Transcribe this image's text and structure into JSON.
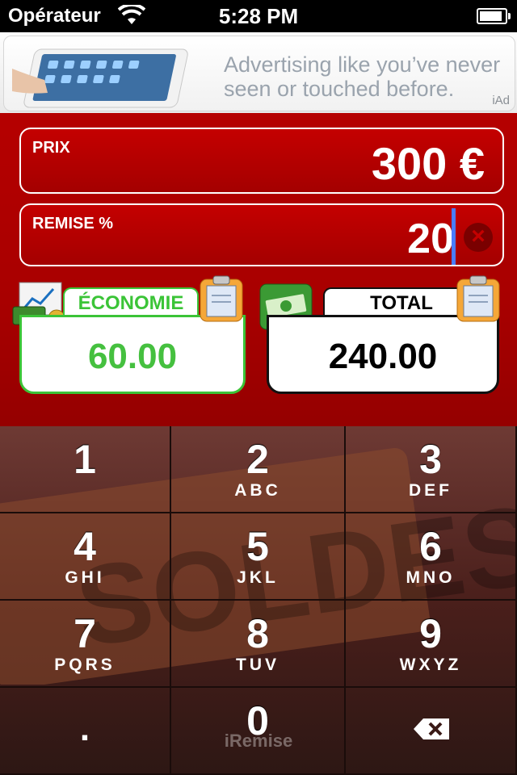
{
  "status_bar": {
    "carrier": "Opérateur",
    "time": "5:28 PM",
    "battery_level": 0.9
  },
  "ad": {
    "text": "Advertising like you’ve never seen or touched before.",
    "badge": "iAd"
  },
  "prix": {
    "label": "PRIX",
    "value": "300 €"
  },
  "remise": {
    "label": "REMISE %",
    "value": "20"
  },
  "economie": {
    "label": "ÉCONOMIE",
    "value": "60.00"
  },
  "total": {
    "label": "TOTAL",
    "value": "240.00"
  },
  "keypad": {
    "keys": [
      {
        "num": "1",
        "letters": ""
      },
      {
        "num": "2",
        "letters": "ABC"
      },
      {
        "num": "3",
        "letters": "DEF"
      },
      {
        "num": "4",
        "letters": "GHI"
      },
      {
        "num": "5",
        "letters": "JKL"
      },
      {
        "num": "6",
        "letters": "MNO"
      },
      {
        "num": "7",
        "letters": "PQRS"
      },
      {
        "num": "8",
        "letters": "TUV"
      },
      {
        "num": "9",
        "letters": "WXYZ"
      },
      {
        "num": ".",
        "letters": ""
      },
      {
        "num": "0",
        "letters": ""
      }
    ],
    "watermark": "SOLDES",
    "brand": "iRemise"
  },
  "colors": {
    "panel_red": "#b00000",
    "green": "#3bc437",
    "caret_blue": "#4a7cff"
  },
  "icons": [
    "wifi-icon",
    "battery-icon",
    "money-chart-icon",
    "cash-icon",
    "clipboard-icon",
    "clear-icon",
    "backspace-icon"
  ]
}
